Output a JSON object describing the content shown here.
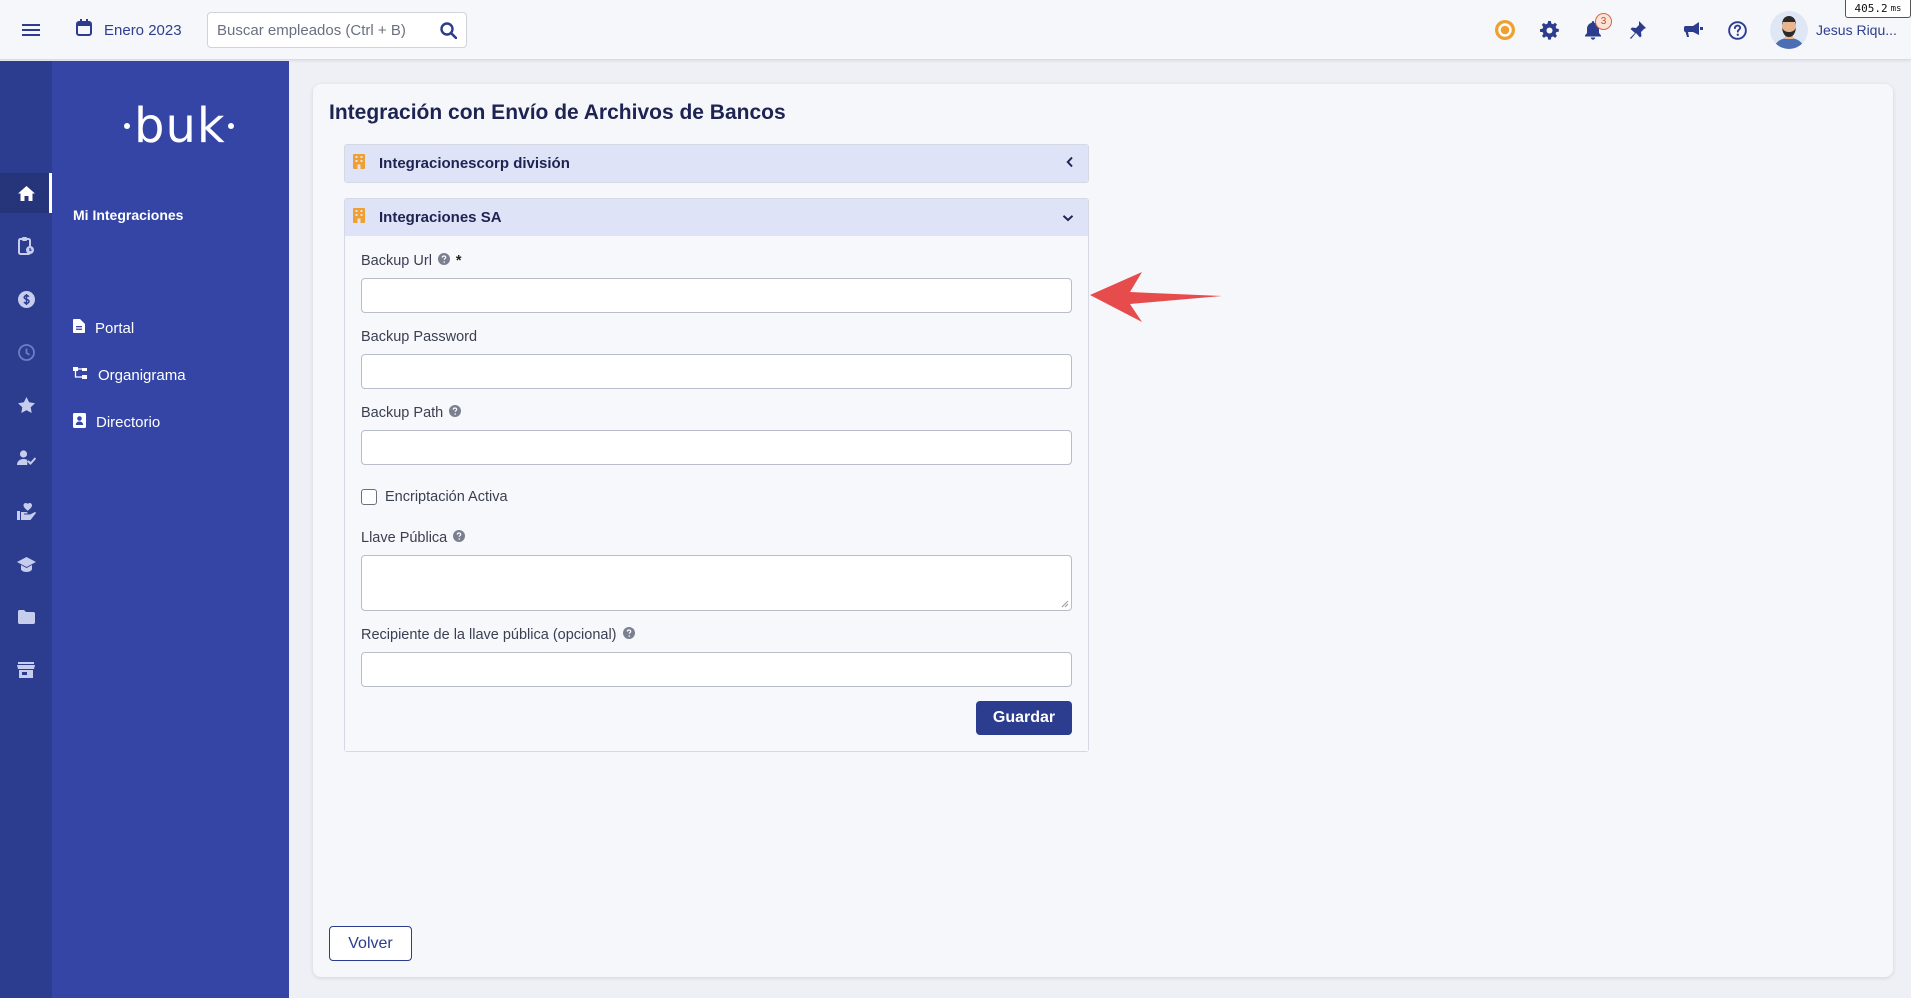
{
  "topbar": {
    "period": "Enero 2023",
    "search_placeholder": "Buscar empleados (Ctrl + B)",
    "notifications_count": "3",
    "user_name": "Jesus Riqu...",
    "perf_value": "405.2",
    "perf_unit": "ms"
  },
  "rail": {
    "icons": [
      "home-icon",
      "clipboard-clock-icon",
      "dollar-icon",
      "clock-icon",
      "star-icon",
      "user-check-icon",
      "hand-heart-icon",
      "graduation-cap-icon",
      "folder-icon",
      "store-icon"
    ],
    "active": "home-icon"
  },
  "sidebar": {
    "logo": "buk",
    "section_title": "Mi Integraciones",
    "items": [
      {
        "label": "Portal",
        "icon": "document-icon"
      },
      {
        "label": "Organigrama",
        "icon": "org-chart-icon"
      },
      {
        "label": "Directorio",
        "icon": "contact-book-icon"
      }
    ]
  },
  "main": {
    "title": "Integración con Envío de Archivos de Bancos",
    "accordions": [
      {
        "title": "Integracionescorp división",
        "expanded": false
      },
      {
        "title": "Integraciones SA",
        "expanded": true
      }
    ],
    "form": {
      "backup_url_label": "Backup Url",
      "required_mark": "*",
      "backup_url_value": "",
      "backup_password_label": "Backup Password",
      "backup_password_value": "",
      "backup_path_label": "Backup Path",
      "backup_path_value": "",
      "encryption_label": "Encriptación Activa",
      "encryption_checked": false,
      "public_key_label": "Llave Pública",
      "public_key_value": "",
      "recipient_label": "Recipiente de la llave pública (opcional)",
      "recipient_value": "",
      "save_label": "Guardar"
    },
    "back_label": "Volver"
  },
  "colors": {
    "primary": "#2c3c8e",
    "sidebar": "#3445a6",
    "accent_orange": "#f0a030",
    "arrow_red": "#e74c4c"
  }
}
